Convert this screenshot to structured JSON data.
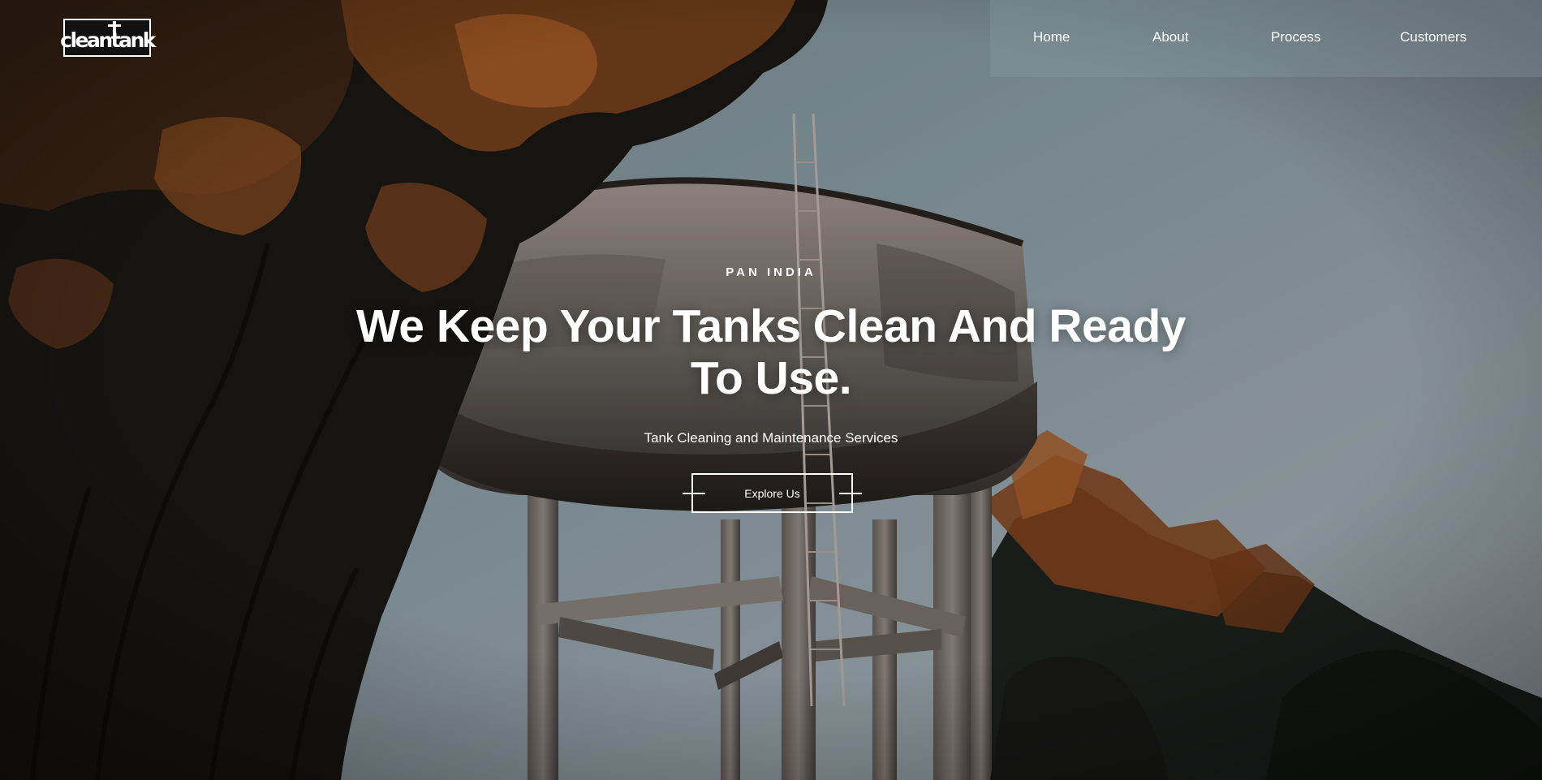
{
  "brand": {
    "logo_text": "cleantank"
  },
  "nav": {
    "items": [
      {
        "label": "Home"
      },
      {
        "label": "About"
      },
      {
        "label": "Process"
      },
      {
        "label": "Customers"
      }
    ]
  },
  "hero": {
    "eyebrow": "PAN INDIA",
    "headline_line1": "We Keep Your Tanks Clean And Ready",
    "headline_line2": "To Use.",
    "subtitle": "Tank Cleaning and Maintenance Services",
    "cta_label": "Explore Us",
    "background_image": "water-tower-photo"
  },
  "colors": {
    "text": "#ffffff",
    "nav_panel": "#8ca0a8",
    "logo_bg": "#111111",
    "sky": "#9aaab3",
    "foliage_orange": "#a8561f",
    "foliage_dark": "#1d1a17"
  }
}
